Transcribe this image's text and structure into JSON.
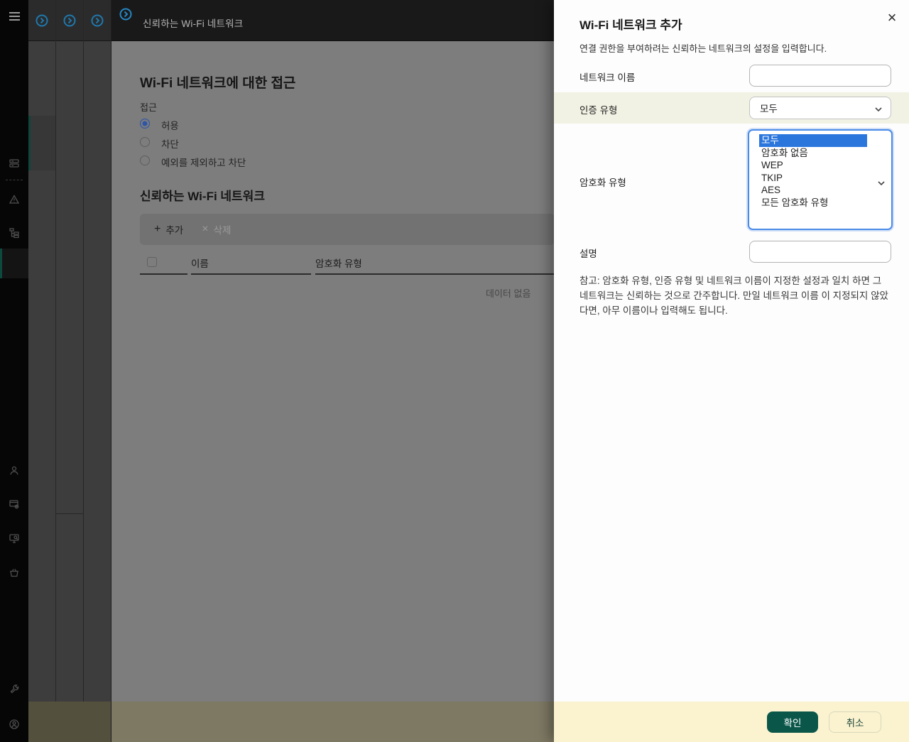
{
  "topbar": {
    "title": "신뢰하는 Wi-Fi 네트워크",
    "panel_toggle_icon": "circle-chevron-right-icon",
    "collapsed_panel_count": 3
  },
  "sidebar": {
    "icons": [
      "menu-icon",
      "devices-icon",
      "alerts-icon",
      "hierarchy-icon",
      "users-icon",
      "app-settings-icon",
      "device-search-icon",
      "marketplace-icon",
      "tools-icon",
      "account-icon"
    ]
  },
  "main": {
    "heading": "Wi-Fi 네트워크에 대한 접근",
    "access": {
      "label": "접근",
      "options": [
        {
          "label": "허용",
          "selected": true
        },
        {
          "label": "차단",
          "selected": false
        },
        {
          "label": "예외를 제외하고 차단",
          "selected": false
        }
      ]
    },
    "section": {
      "heading": "신뢰하는 Wi-Fi 네트워크",
      "toolbar": {
        "add_icon": "+",
        "add": "추가",
        "delete_icon": "×",
        "delete": "삭제"
      },
      "table": {
        "columns": [
          "이름",
          "암호화 유형"
        ],
        "empty": "데이터 없음"
      }
    }
  },
  "modal": {
    "title": "Wi-Fi 네트워크 추가",
    "close_icon": "×",
    "description": "연결 권한을 부여하려는 신뢰하는 네트워크의 설정을 입력합니다.",
    "fields": {
      "network_name": {
        "label": "네트워크 이름",
        "value": "",
        "placeholder": ""
      },
      "auth_type": {
        "label": "인증 유형",
        "value": "모두"
      },
      "encryption_type": {
        "label": "암호화 유형",
        "selected": "모두",
        "options": [
          "모두",
          "암호화 없음",
          "WEP",
          "TKIP",
          "AES",
          "모든 암호화 유형"
        ]
      },
      "comment": {
        "label": "설명",
        "value": "",
        "placeholder": ""
      }
    },
    "note": "참고: 암호화 유형, 인증 유형 및 네트워크 이름이 지정한 설정과 일치 하면 그 네트워크는 신뢰하는 것으로 간주합니다. 만일 네트워크 이름 이 지정되지 않았다면, 아무 이름이나 입력해도 됩니다.",
    "buttons": {
      "ok": "확인",
      "cancel": "취소"
    }
  },
  "colors": {
    "accent_teal": "#0a574a",
    "selection_blue": "#2b76dd",
    "focus_border_blue": "#4a8be8",
    "row_highlight": "#f2f2e4",
    "footer_yellow": "#fbf3cf",
    "radio_blue": "#2d55a8",
    "panel_icon_blue": "#1f78ad"
  }
}
